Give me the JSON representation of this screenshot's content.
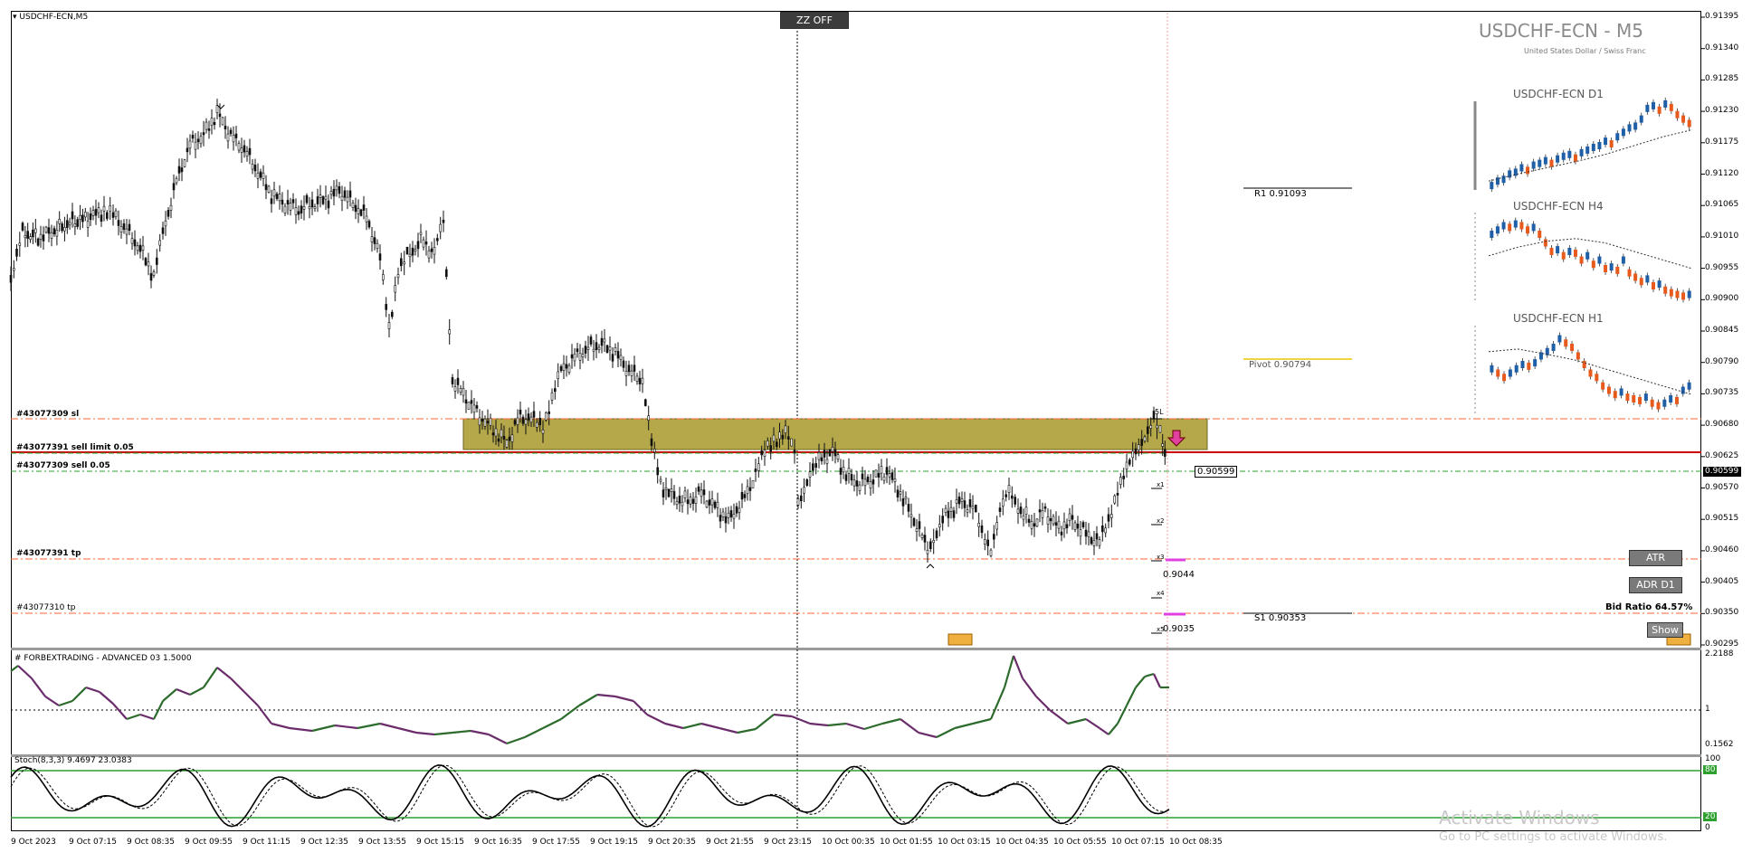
{
  "symbol_header": "USDCHF-ECN,M5",
  "title": "USDCHF-ECN - M5",
  "subtitle": "United States Dollar / Swiss Franc",
  "zz_button": "ZZ OFF",
  "mtf_panels": [
    "USDCHF-ECN D1",
    "USDCHF-ECN H4",
    "USDCHF-ECN H1"
  ],
  "pivots": {
    "r1": "R1 0.91093",
    "pivot": "Pivot 0.90794",
    "s1": "S1 0.90353"
  },
  "orders": {
    "sl": "#43077309 sl",
    "sell_limit": "#43077391 sell limit 0.05",
    "sell": "#43077309 sell 0.05",
    "tp1": "#43077391 tp",
    "tp2": "#43077310 tp"
  },
  "targets": {
    "t1": "x1",
    "t2": "x2",
    "t3": "x3",
    "t4": "x4",
    "t5": "x5",
    "top": "5L",
    "level1": "0.9044",
    "level2": "0.9035"
  },
  "current_price": "0.90599",
  "current_price_axis": "0.90599",
  "buttons": {
    "atr": "ATR",
    "adr": "ADR D1",
    "show": "Show"
  },
  "bid_ratio": "Bid Ratio 64.57%",
  "price_axis": [
    "0.91395",
    "0.91340",
    "0.91285",
    "0.91230",
    "0.91175",
    "0.91120",
    "0.91065",
    "0.91010",
    "0.90955",
    "0.90900",
    "0.90845",
    "0.90790",
    "0.90735",
    "0.90680",
    "0.90625",
    "0.90570",
    "0.90515",
    "0.90460",
    "0.90405",
    "0.90350",
    "0.90295"
  ],
  "indicator1": {
    "label": "# FORBEXTRADING - ADVANCED 03 1.5000",
    "axis": [
      "2.2188",
      "1",
      "0.1562"
    ]
  },
  "indicator2": {
    "label": "Stoch(8,3,3) 9.4697 23.0383",
    "axis": [
      "100",
      "80",
      "20",
      "0"
    ]
  },
  "time_axis": [
    "9 Oct 2023",
    "9 Oct 07:15",
    "9 Oct 08:35",
    "9 Oct 09:55",
    "9 Oct 11:15",
    "9 Oct 12:35",
    "9 Oct 13:55",
    "9 Oct 15:15",
    "9 Oct 16:35",
    "9 Oct 17:55",
    "9 Oct 19:15",
    "9 Oct 20:35",
    "9 Oct 21:55",
    "9 Oct 23:15",
    "10 Oct 00:35",
    "10 Oct 01:55",
    "10 Oct 03:15",
    "10 Oct 04:35",
    "10 Oct 05:55",
    "10 Oct 07:15",
    "10 Oct 08:35"
  ],
  "activation": {
    "line1": "Activate Windows",
    "line2": "Go to PC settings to activate Windows."
  },
  "colors": {
    "zone": "#b5a84a",
    "resistance": "#cc0000",
    "pivot": "#e8c800",
    "stoch_levels": "#2ea02e",
    "ind_up": "#2c6b2c",
    "ind_down": "#6a2c6a",
    "tp": "#ff6633",
    "target_mark": "#e040e0",
    "bull": "#1f5fa8",
    "bear": "#e85a1c"
  },
  "icons": {
    "sell_arrow": "sell-arrow-icon",
    "header_triangle": "dropdown-triangle-icon"
  }
}
